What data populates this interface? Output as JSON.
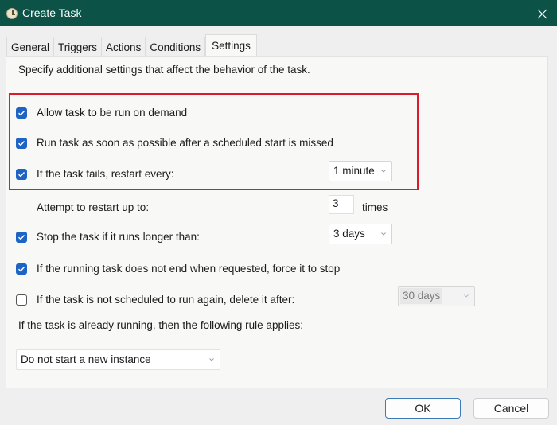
{
  "window": {
    "title": "Create Task",
    "icon": "clock-icon",
    "close_icon": "close-icon"
  },
  "tabs": [
    {
      "label": "General",
      "active": false
    },
    {
      "label": "Triggers",
      "active": false
    },
    {
      "label": "Actions",
      "active": false
    },
    {
      "label": "Conditions",
      "active": false
    },
    {
      "label": "Settings",
      "active": true
    }
  ],
  "settings": {
    "description": "Specify additional settings that affect the behavior of the task.",
    "allow_on_demand": {
      "label": "Allow task to be run on demand",
      "checked": true
    },
    "run_missed": {
      "label": "Run task as soon as possible after a scheduled start is missed",
      "checked": true
    },
    "restart_on_fail": {
      "label": "If the task fails, restart every:",
      "checked": true,
      "value": "1 minute"
    },
    "restart_attempts": {
      "label": "Attempt to restart up to:",
      "value": "3",
      "suffix": "times"
    },
    "stop_if_longer": {
      "label": "Stop the task if it runs longer than:",
      "checked": true,
      "value": "3 days"
    },
    "force_stop": {
      "label": "If the running task does not end when requested, force it to stop",
      "checked": true
    },
    "delete_after": {
      "label": "If the task is not scheduled to run again, delete it after:",
      "checked": false,
      "value": "30 days",
      "enabled": false
    },
    "running_rule": {
      "label": "If the task is already running, then the following rule applies:",
      "value": "Do not start a new instance"
    }
  },
  "highlight": {
    "color": "#d81c2e"
  },
  "colors": {
    "titlebar": "#0d5246",
    "checkbox_accent": "#1d64c4",
    "ok_border": "#3c7bb8"
  },
  "buttons": {
    "ok": "OK",
    "cancel": "Cancel"
  }
}
